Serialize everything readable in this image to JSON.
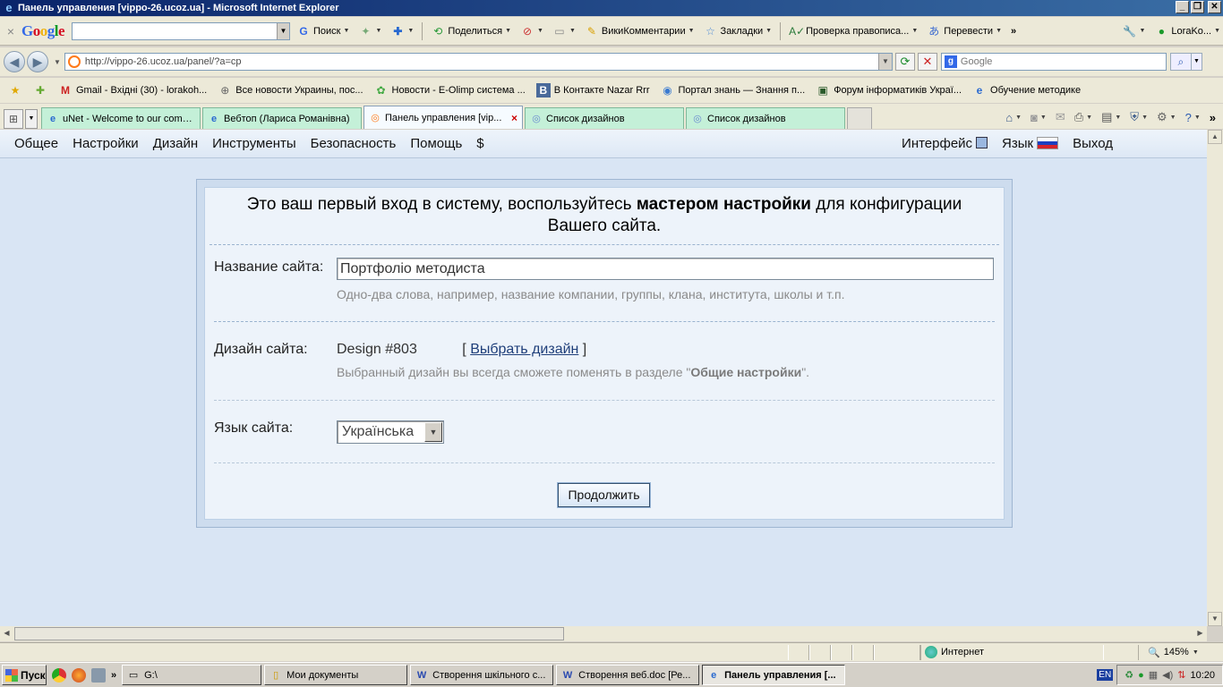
{
  "window": {
    "title": "Панель управления [vippo-26.ucoz.ua] - Microsoft Internet Explorer"
  },
  "google_toolbar": {
    "logo": "Google",
    "items": [
      "Поиск",
      "Поделиться",
      "ВикиКомментарии",
      "Закладки",
      "Проверка правописа...",
      "Перевести",
      "LoraKo..."
    ]
  },
  "address_bar": {
    "url": "http://vippo-26.ucoz.ua/panel/?a=cp",
    "search_placeholder": "Google"
  },
  "favorites": [
    {
      "label": "Gmail - Вхідні (30) - lorakoh...",
      "icon": "gmail-icon"
    },
    {
      "label": "Все новости Украины, пос...",
      "icon": "news-icon"
    },
    {
      "label": "Новости - E-Olimp система ...",
      "icon": "eolimp-icon"
    },
    {
      "label": "В Контакте  Nazar Rrr",
      "icon": "vk-icon"
    },
    {
      "label": "Портал знань — Знання п...",
      "icon": "portal-icon"
    },
    {
      "label": "Форум інформатиків Украї...",
      "icon": "forum-icon"
    },
    {
      "label": "Обучение методике",
      "icon": "ie-icon"
    }
  ],
  "tabs": [
    {
      "label": "uNet - Welcome to our comm...",
      "active": false
    },
    {
      "label": "Вебтоп (Лариса Романівна)",
      "active": false
    },
    {
      "label": "Панель управления [vip...",
      "active": true
    },
    {
      "label": "Список дизайнов",
      "active": false
    },
    {
      "label": "Список дизайнов",
      "active": false
    }
  ],
  "panel_nav": {
    "items": [
      "Общее",
      "Настройки",
      "Дизайн",
      "Инструменты",
      "Безопасность",
      "Помощь",
      "$"
    ],
    "interface": "Интерфейс",
    "language": "Язык",
    "logout": "Выход"
  },
  "wizard": {
    "intro_pre": "Это ваш первый вход в систему, воспользуйтесь ",
    "intro_bold": "мастером настройки",
    "intro_post": " для конфигурации Вашего сайта.",
    "site_name_label": "Название сайта:",
    "site_name_value": "Портфоліо методиста",
    "site_name_hint": "Одно-два слова, например, название компании, группы, клана, института, школы и т.п.",
    "design_label": "Дизайн сайта:",
    "design_value": "Design #803",
    "choose_design_link": "Выбрать дизайн",
    "design_hint_pre": "Выбранный дизайн вы всегда сможете поменять в разделе \"",
    "design_hint_bold": "Общие настройки",
    "design_hint_post": "\".",
    "language_label": "Язык сайта:",
    "language_value": "Українська",
    "continue_button": "Продолжить"
  },
  "status_bar": {
    "zone": "Интернет",
    "zoom": "145%"
  },
  "taskbar": {
    "start": "Пуск",
    "drive": "G:\\",
    "tasks": [
      {
        "label": "Мои документы",
        "active": false
      },
      {
        "label": "Створення шкільного с...",
        "active": false
      },
      {
        "label": "Створення веб.doc [Ре...",
        "active": false
      },
      {
        "label": "Панель управления [...",
        "active": true
      }
    ],
    "lang": "EN",
    "time": "10:20"
  },
  "colors": {
    "page_bg": "#d9e5f4",
    "tab_inactive": "#c4f0d8",
    "link": "#1f3f7a"
  }
}
